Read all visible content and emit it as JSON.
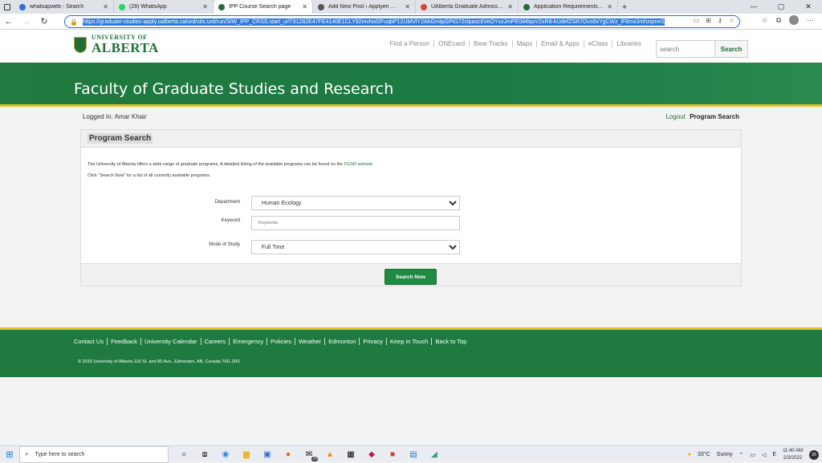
{
  "browser": {
    "tabs": [
      {
        "title": "whatsapweb - Search",
        "color": "#2f6fd8",
        "active": false
      },
      {
        "title": "(28) WhatsApp",
        "color": "#25d366",
        "active": false
      },
      {
        "title": "IPP Course Search page",
        "color": "#1f6e35",
        "active": true
      },
      {
        "title": "Add New Post ‹ Applyen — Wor",
        "color": "#555555",
        "active": false
      },
      {
        "title": "UAlberta Graduate Admissions A",
        "color": "#d44638",
        "active": false
      },
      {
        "title": "Application Requirements for Ac",
        "color": "#1f6e35",
        "active": false
      }
    ],
    "url": "https://graduate-studies-apply.ualberta.ca/urd/sits.urd/run/SIW_IPP_CRSS.start_url?31282E47FE4140E1CLY92mvNxl2FuqbP12UMVlY2AhGmtpGPiG72clpasc6VeOYvoJmPE0il4lquV2xR8-kUdefZSR7Ovs6xYgCWz_iF8mx3mhzqmeS"
  },
  "header": {
    "logo_small": "UNIVERSITY OF",
    "logo_big": "ALBERTA",
    "links": [
      "Find a Person",
      "ONEcard",
      "Bear Tracks",
      "Maps",
      "Email & Apps",
      "eClass",
      "Libraries"
    ],
    "search_placeholder": "search",
    "search_button": "Search"
  },
  "banner": {
    "title": "Faculty of Graduate Studies and Research"
  },
  "session": {
    "logged_in": "Logged In: Amar Khair",
    "logout": "Logout",
    "current": "Program Search"
  },
  "panel": {
    "title": "Program Search",
    "intro_1": "The University of Alberta offers a wide range of graduate programs. A detailed listing of the available programs can be found on the",
    "intro_link": "FGSR website",
    "intro_1_end": ".",
    "intro_2": "Click \"Search Now\" for a list of all currently available programs.",
    "department_label": "Department",
    "department_value": "Human Ecology",
    "keyword_label": "Keyword",
    "keyword_placeholder": "Keywords",
    "mode_label": "Mode of Study",
    "mode_value": "Full Time",
    "search_now": "Search Now"
  },
  "footer": {
    "links": [
      "Contact Us",
      "Feedback",
      "University Calendar",
      "Careers",
      "Emergency",
      "Policies",
      "Weather",
      "Edmonton",
      "Privacy",
      "Keep in Touch",
      "Back to Top"
    ],
    "copyright": "© 2015 University of Alberta 116 St. and 85 Ave., Edmonton, AB, Canada T6G 2R3"
  },
  "taskbar": {
    "search_text": "Type here to search",
    "mail_badge": "28",
    "weather_temp": "33°C",
    "weather_desc": "Sunny",
    "time": "11:40 AM",
    "date": "2/3/2022",
    "notif_count": "26"
  }
}
